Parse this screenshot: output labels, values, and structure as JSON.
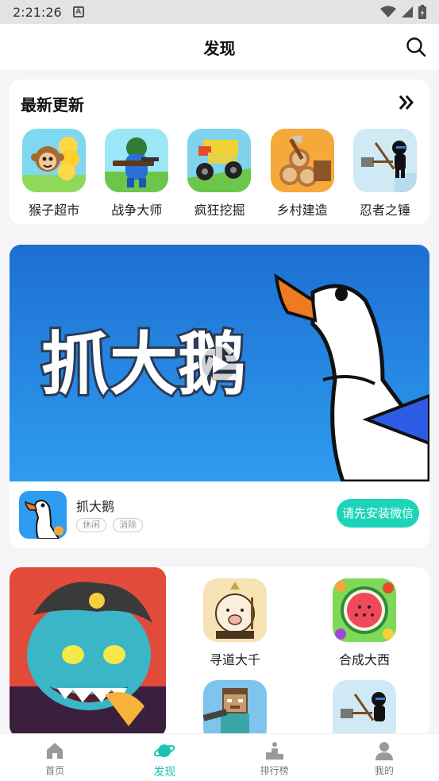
{
  "status_bar": {
    "time": "2:21:26",
    "notification_letter": "A"
  },
  "header": {
    "title": "发现"
  },
  "latest": {
    "title": "最新更新",
    "games": [
      {
        "name": "猴子超市",
        "icon": "monkey-market-icon"
      },
      {
        "name": "战争大师",
        "icon": "war-master-icon"
      },
      {
        "name": "疯狂挖掘",
        "icon": "crazy-dig-icon"
      },
      {
        "name": "乡村建造",
        "icon": "village-build-icon"
      },
      {
        "name": "忍者之锤",
        "icon": "ninja-hammer-icon"
      }
    ]
  },
  "featured": {
    "name": "抓大鹅",
    "banner_text": "抓大鹅",
    "tags": [
      "休闲",
      "消除"
    ],
    "install_label": "请先安装微信"
  },
  "grid": {
    "games": [
      {
        "name": "寻道大千",
        "icon": "xundao-icon"
      },
      {
        "name": "合成大西",
        "icon": "watermelon-icon"
      },
      {
        "name": "",
        "icon": "minecraft-like-icon"
      },
      {
        "name": "",
        "icon": "ninja-hammer-icon"
      }
    ]
  },
  "nav": {
    "items": [
      {
        "label": "首页",
        "icon": "home-icon"
      },
      {
        "label": "发现",
        "icon": "planet-icon"
      },
      {
        "label": "排行榜",
        "icon": "podium-icon"
      },
      {
        "label": "我的",
        "icon": "user-icon"
      }
    ],
    "active_color": "#1dc2b0"
  },
  "colors": {
    "accent": "#1dd4b9",
    "banner_blue": "#2d8fe6"
  }
}
